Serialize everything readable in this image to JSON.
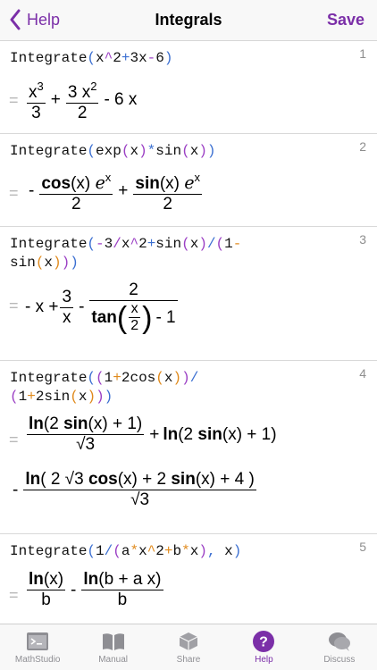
{
  "nav": {
    "back_label": "Help",
    "title": "Integrals",
    "save_label": "Save"
  },
  "colors": {
    "accent": "#7b2fa8",
    "token_blue": "#3b6fd1",
    "token_purple": "#9b3fc4",
    "token_orange": "#e08a1c",
    "eq_gray": "#b8b8b8"
  },
  "entries": [
    {
      "num": "1",
      "input": "Integrate(x^2+3x-6)",
      "output": {
        "t1_num": "x3",
        "t1_den": "3",
        "plus": "+",
        "t2_num": "3 x2",
        "t2_den": "2",
        "tail": "- 6 x"
      }
    },
    {
      "num": "2",
      "input": "Integrate(exp(x)*sin(x))",
      "output": {
        "minus": "-",
        "t1_num_a": "cos",
        "t1_num_b": "(x) ",
        "t1_num_c": "ℯ",
        "t1_num_d": "x",
        "t1_den": "2",
        "plus": "+",
        "t2_num_a": "sin",
        "t2_num_b": "(x) ",
        "t2_num_c": "ℯ",
        "t2_num_d": "x",
        "t2_den": "2"
      }
    },
    {
      "num": "3",
      "input_line1": "Integrate(-3/x^2+sin(x)/(1-",
      "input_line2": "sin(x)))",
      "output": {
        "lead": "- x +",
        "f1_num": "3",
        "f1_den": "x",
        "minus": "-",
        "f2_num": "2",
        "tan": "tan",
        "inner_num": "x",
        "inner_den": "2",
        "tail": "- 1"
      }
    },
    {
      "num": "4",
      "input_line1": "Integrate((1+2cos(x))/",
      "input_line2": "(1+2sin(x)))",
      "output": {
        "a_num": "ln(2 sin(x) + 1)",
        "a_den": "√3",
        "plus": "+",
        "b": "ln(2 sin(x) + 1)",
        "minus": "-",
        "c_num": "ln( 2 √3 cos(x) + 2 sin(x) + 4 )",
        "c_den": "√3"
      }
    },
    {
      "num": "5",
      "input": "Integrate(1/(a*x^2+b*x), x)",
      "output": {
        "a_num": "ln(x)",
        "a_den": "b",
        "minus": "-",
        "b_num": "ln(b + a x)",
        "b_den": "b"
      }
    }
  ],
  "tabs": [
    {
      "label": "MathStudio",
      "icon": "terminal-icon"
    },
    {
      "label": "Manual",
      "icon": "book-icon"
    },
    {
      "label": "Share",
      "icon": "share-icon"
    },
    {
      "label": "Help",
      "icon": "help-icon",
      "active": true
    },
    {
      "label": "Discuss",
      "icon": "chat-icon"
    }
  ]
}
